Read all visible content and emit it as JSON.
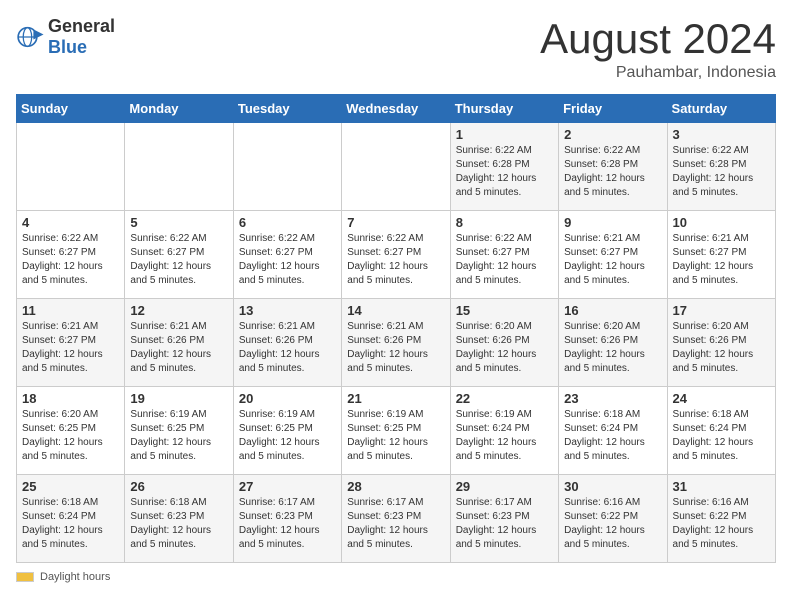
{
  "header": {
    "logo_general": "General",
    "logo_blue": "Blue",
    "title": "August 2024",
    "subtitle": "Pauhambar, Indonesia"
  },
  "days_of_week": [
    "Sunday",
    "Monday",
    "Tuesday",
    "Wednesday",
    "Thursday",
    "Friday",
    "Saturday"
  ],
  "weeks": [
    [
      {
        "day": "",
        "info": ""
      },
      {
        "day": "",
        "info": ""
      },
      {
        "day": "",
        "info": ""
      },
      {
        "day": "",
        "info": ""
      },
      {
        "day": "1",
        "info": "Sunrise: 6:22 AM\nSunset: 6:28 PM\nDaylight: 12 hours\nand 5 minutes."
      },
      {
        "day": "2",
        "info": "Sunrise: 6:22 AM\nSunset: 6:28 PM\nDaylight: 12 hours\nand 5 minutes."
      },
      {
        "day": "3",
        "info": "Sunrise: 6:22 AM\nSunset: 6:28 PM\nDaylight: 12 hours\nand 5 minutes."
      }
    ],
    [
      {
        "day": "4",
        "info": "Sunrise: 6:22 AM\nSunset: 6:27 PM\nDaylight: 12 hours\nand 5 minutes."
      },
      {
        "day": "5",
        "info": "Sunrise: 6:22 AM\nSunset: 6:27 PM\nDaylight: 12 hours\nand 5 minutes."
      },
      {
        "day": "6",
        "info": "Sunrise: 6:22 AM\nSunset: 6:27 PM\nDaylight: 12 hours\nand 5 minutes."
      },
      {
        "day": "7",
        "info": "Sunrise: 6:22 AM\nSunset: 6:27 PM\nDaylight: 12 hours\nand 5 minutes."
      },
      {
        "day": "8",
        "info": "Sunrise: 6:22 AM\nSunset: 6:27 PM\nDaylight: 12 hours\nand 5 minutes."
      },
      {
        "day": "9",
        "info": "Sunrise: 6:21 AM\nSunset: 6:27 PM\nDaylight: 12 hours\nand 5 minutes."
      },
      {
        "day": "10",
        "info": "Sunrise: 6:21 AM\nSunset: 6:27 PM\nDaylight: 12 hours\nand 5 minutes."
      }
    ],
    [
      {
        "day": "11",
        "info": "Sunrise: 6:21 AM\nSunset: 6:27 PM\nDaylight: 12 hours\nand 5 minutes."
      },
      {
        "day": "12",
        "info": "Sunrise: 6:21 AM\nSunset: 6:26 PM\nDaylight: 12 hours\nand 5 minutes."
      },
      {
        "day": "13",
        "info": "Sunrise: 6:21 AM\nSunset: 6:26 PM\nDaylight: 12 hours\nand 5 minutes."
      },
      {
        "day": "14",
        "info": "Sunrise: 6:21 AM\nSunset: 6:26 PM\nDaylight: 12 hours\nand 5 minutes."
      },
      {
        "day": "15",
        "info": "Sunrise: 6:20 AM\nSunset: 6:26 PM\nDaylight: 12 hours\nand 5 minutes."
      },
      {
        "day": "16",
        "info": "Sunrise: 6:20 AM\nSunset: 6:26 PM\nDaylight: 12 hours\nand 5 minutes."
      },
      {
        "day": "17",
        "info": "Sunrise: 6:20 AM\nSunset: 6:26 PM\nDaylight: 12 hours\nand 5 minutes."
      }
    ],
    [
      {
        "day": "18",
        "info": "Sunrise: 6:20 AM\nSunset: 6:25 PM\nDaylight: 12 hours\nand 5 minutes."
      },
      {
        "day": "19",
        "info": "Sunrise: 6:19 AM\nSunset: 6:25 PM\nDaylight: 12 hours\nand 5 minutes."
      },
      {
        "day": "20",
        "info": "Sunrise: 6:19 AM\nSunset: 6:25 PM\nDaylight: 12 hours\nand 5 minutes."
      },
      {
        "day": "21",
        "info": "Sunrise: 6:19 AM\nSunset: 6:25 PM\nDaylight: 12 hours\nand 5 minutes."
      },
      {
        "day": "22",
        "info": "Sunrise: 6:19 AM\nSunset: 6:24 PM\nDaylight: 12 hours\nand 5 minutes."
      },
      {
        "day": "23",
        "info": "Sunrise: 6:18 AM\nSunset: 6:24 PM\nDaylight: 12 hours\nand 5 minutes."
      },
      {
        "day": "24",
        "info": "Sunrise: 6:18 AM\nSunset: 6:24 PM\nDaylight: 12 hours\nand 5 minutes."
      }
    ],
    [
      {
        "day": "25",
        "info": "Sunrise: 6:18 AM\nSunset: 6:24 PM\nDaylight: 12 hours\nand 5 minutes."
      },
      {
        "day": "26",
        "info": "Sunrise: 6:18 AM\nSunset: 6:23 PM\nDaylight: 12 hours\nand 5 minutes."
      },
      {
        "day": "27",
        "info": "Sunrise: 6:17 AM\nSunset: 6:23 PM\nDaylight: 12 hours\nand 5 minutes."
      },
      {
        "day": "28",
        "info": "Sunrise: 6:17 AM\nSunset: 6:23 PM\nDaylight: 12 hours\nand 5 minutes."
      },
      {
        "day": "29",
        "info": "Sunrise: 6:17 AM\nSunset: 6:23 PM\nDaylight: 12 hours\nand 5 minutes."
      },
      {
        "day": "30",
        "info": "Sunrise: 6:16 AM\nSunset: 6:22 PM\nDaylight: 12 hours\nand 5 minutes."
      },
      {
        "day": "31",
        "info": "Sunrise: 6:16 AM\nSunset: 6:22 PM\nDaylight: 12 hours\nand 5 minutes."
      }
    ]
  ],
  "legend": {
    "daylight_label": "Daylight hours"
  }
}
